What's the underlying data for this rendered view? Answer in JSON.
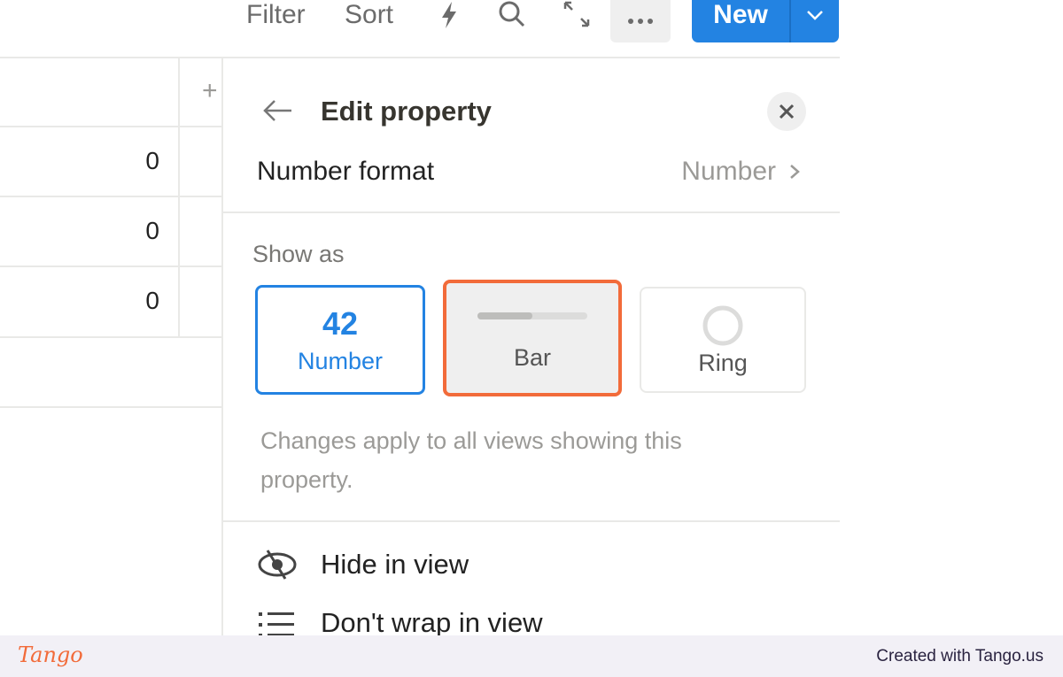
{
  "toolbar": {
    "filter": "Filter",
    "sort": "Sort",
    "new_label": "New",
    "icons": [
      "lightning-icon",
      "search-icon",
      "expand-icon",
      "more-icon",
      "chevron-down-icon"
    ]
  },
  "table": {
    "add_column": "+",
    "rows": [
      "0",
      "0",
      "0"
    ]
  },
  "panel": {
    "title": "Edit property",
    "number_format_label": "Number format",
    "number_format_value": "Number",
    "show_as_label": "Show as",
    "options": [
      {
        "value": "42",
        "label": "Number"
      },
      {
        "label": "Bar"
      },
      {
        "label": "Ring"
      }
    ],
    "note": "Changes apply to all views showing this property.",
    "menu": [
      {
        "label": "Hide in view",
        "icon": "eye-off-icon"
      },
      {
        "label": "Don't wrap in view",
        "icon": "list-icon"
      }
    ]
  },
  "colors": {
    "accent": "#2383e2",
    "highlight": "#f26b3a"
  },
  "footer": {
    "logo": "Tango",
    "credit": "Created with Tango.us"
  }
}
